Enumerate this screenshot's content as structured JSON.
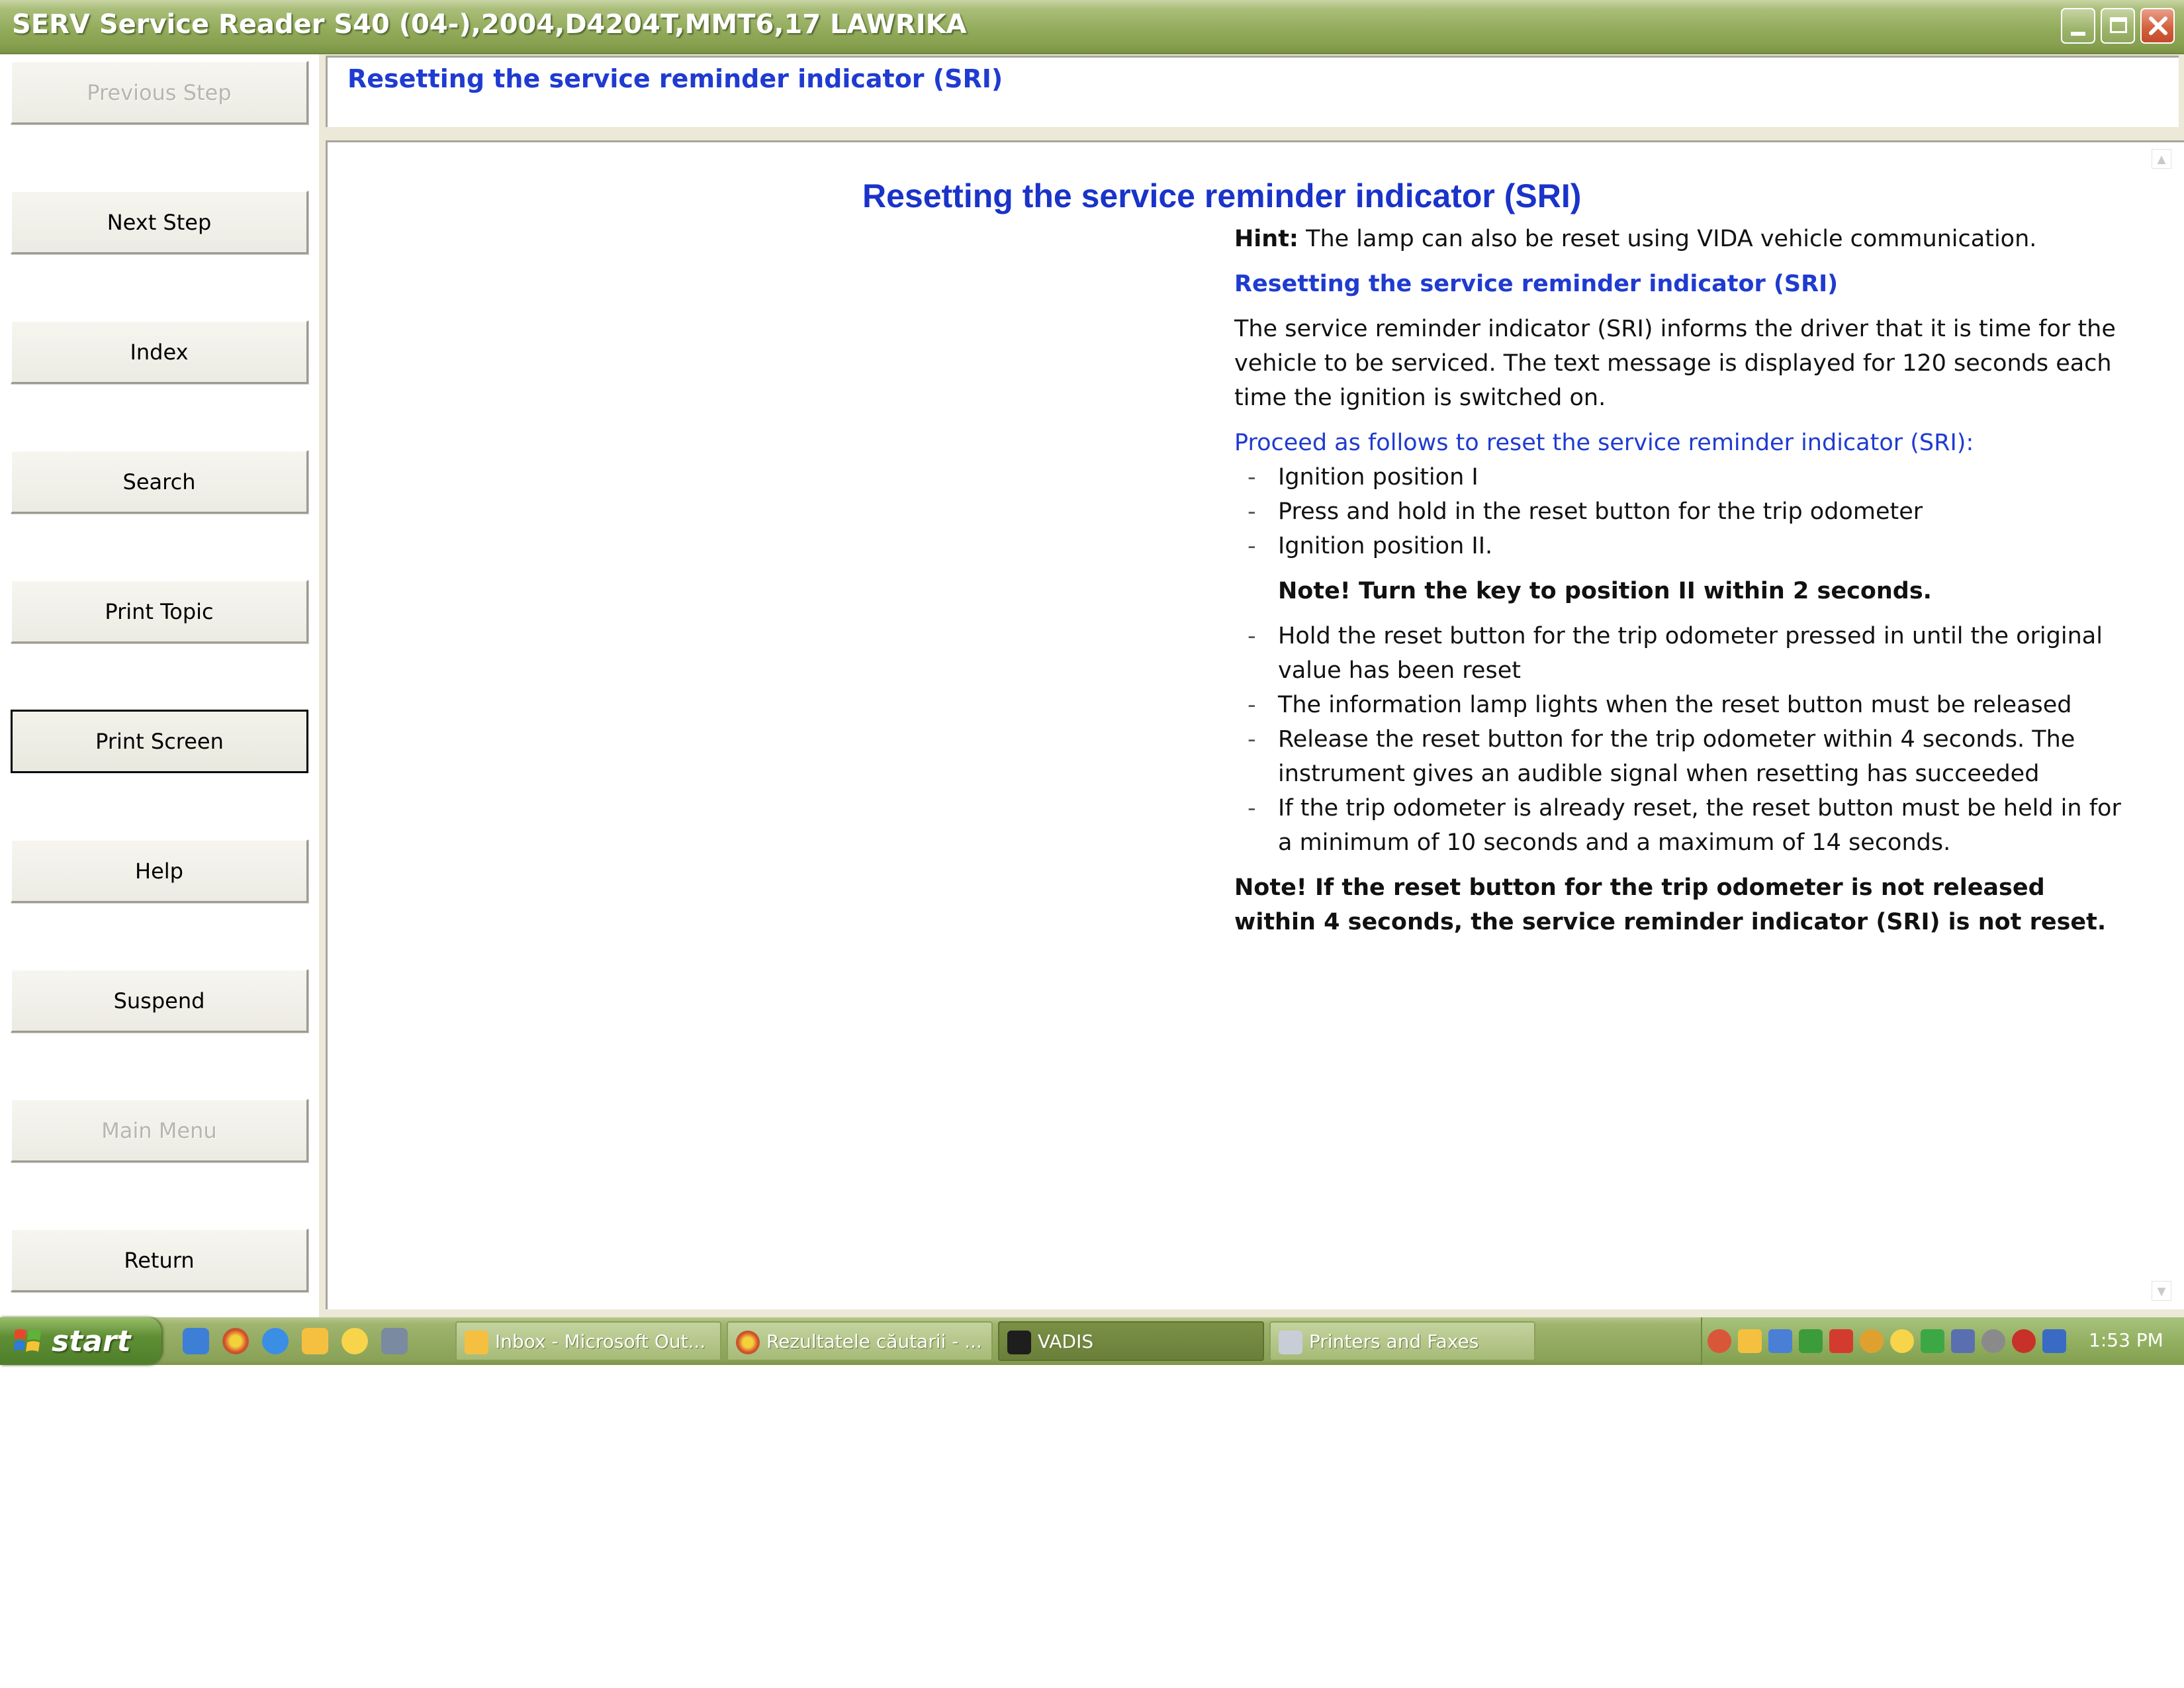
{
  "window": {
    "title": "SERV Service Reader S40 (04-),2004,D4204T,MMT6,17 LAWRIKA"
  },
  "nav": {
    "previous_step": "Previous Step",
    "next_step": "Next Step",
    "index": "Index",
    "search": "Search",
    "print_topic": "Print Topic",
    "print_screen": "Print Screen",
    "help": "Help",
    "suspend": "Suspend",
    "main_menu": "Main Menu",
    "return": "Return"
  },
  "header": {
    "title": "Resetting the service reminder indicator (SRI)"
  },
  "document": {
    "title": "Resetting the service reminder indicator (SRI)",
    "hint_label": "Hint:",
    "hint_text": " The lamp can also be reset using VIDA vehicle communication.",
    "subheading": "Resetting the service reminder indicator (SRI)",
    "intro": "The service reminder indicator (SRI) informs the driver that it is time for the vehicle to be serviced. The text message is displayed for 120 seconds each time the ignition is switched on.",
    "proceed": "Proceed as follows to reset the service reminder indicator (SRI):",
    "steps_a": [
      "Ignition position I",
      "Press and hold in the reset button for the trip odometer",
      "Ignition position II."
    ],
    "note_inline": "Note! Turn the key to position II within 2 seconds.",
    "steps_b": [
      "Hold the reset button for the trip odometer pressed in until the original value has been reset",
      "The information lamp lights when the reset button must be released",
      "Release the reset button for the trip odometer within 4 seconds. The instrument gives an audible signal when resetting has succeeded",
      "If the trip odometer is already reset, the reset button must be held in for a minimum of 10 seconds and a maximum of 14 seconds."
    ],
    "note_final": "Note! If the reset button for the trip odometer is not released within 4 seconds, the service reminder indicator (SRI) is not reset.",
    "dash": "-"
  },
  "taskbar": {
    "start_label": "start",
    "tasks": [
      "Inbox - Microsoft Out...",
      "Rezultatele căutarii - ...",
      "VADIS",
      "Printers and Faxes"
    ],
    "clock": "1:53 PM"
  },
  "colors": {
    "heading_blue": "#1f3bd1",
    "title_blue": "#1a33c9",
    "titlebar_green": "#93ac5c"
  }
}
